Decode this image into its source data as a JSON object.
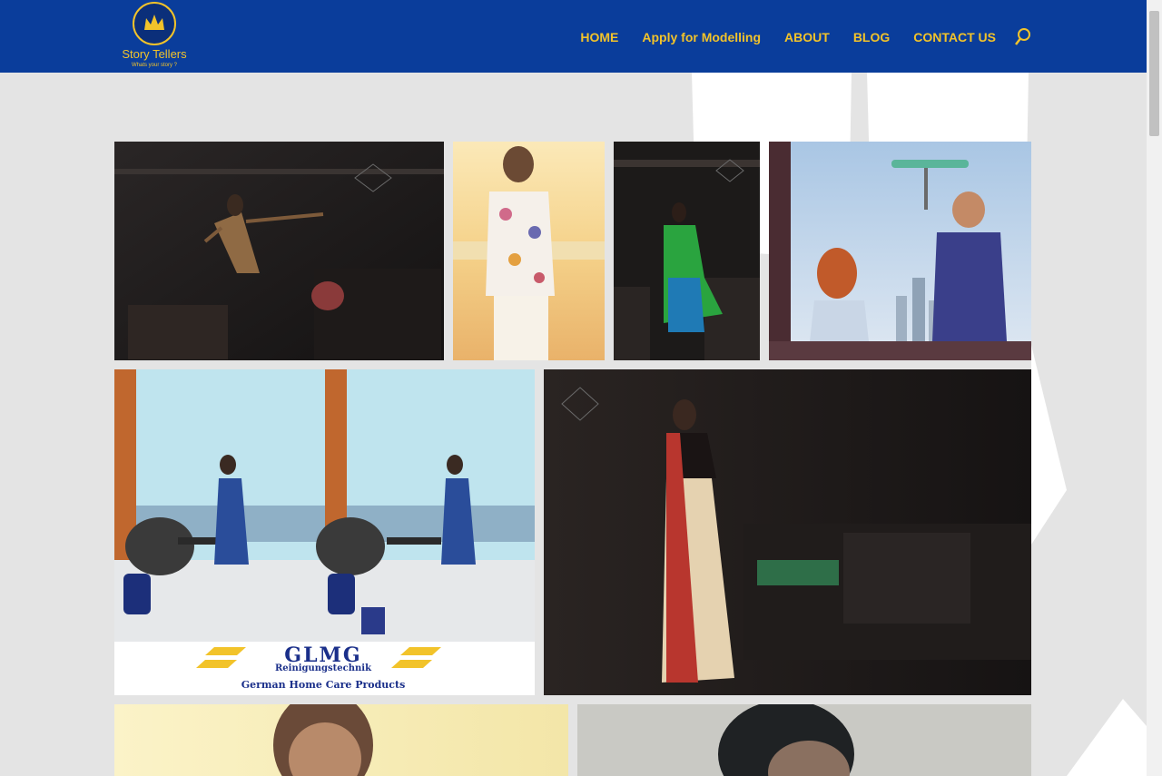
{
  "brand": {
    "name": "Story Tellers",
    "tagline": "Whats your story ?"
  },
  "nav": {
    "items": [
      {
        "label": "HOME",
        "name": "nav-home"
      },
      {
        "label": "Apply for Modelling",
        "name": "nav-apply-modelling"
      },
      {
        "label": "ABOUT",
        "name": "nav-about"
      },
      {
        "label": "BLOG",
        "name": "nav-blog"
      },
      {
        "label": "CONTACT US",
        "name": "nav-contact-us"
      }
    ]
  },
  "gallery": {
    "tiles": [
      {
        "name": "photo-factory-dress",
        "subject": "model in printed dress inside factory"
      },
      {
        "name": "photo-beach-shirt",
        "subject": "man in floral shirt on beach"
      },
      {
        "name": "photo-factory-green-saree",
        "subject": "model in green saree in factory"
      },
      {
        "name": "photo-window-cleaner",
        "subject": "man cleaning window with child"
      },
      {
        "name": "photo-glmg-ad",
        "subject": "home care product advertisement"
      },
      {
        "name": "photo-factory-saree",
        "subject": "model in saree near loom"
      },
      {
        "name": "photo-man-light",
        "subject": "portrait of man"
      },
      {
        "name": "photo-man-dark",
        "subject": "close portrait of man"
      }
    ],
    "ad": {
      "brand_text": "GLMG",
      "subtitle": "Reinigungstechnik",
      "caption": "German Home Care Products"
    }
  },
  "colors": {
    "header_bg": "#0a3d9b",
    "accent": "#f2c32a",
    "page_bg": "#e4e4e4"
  }
}
